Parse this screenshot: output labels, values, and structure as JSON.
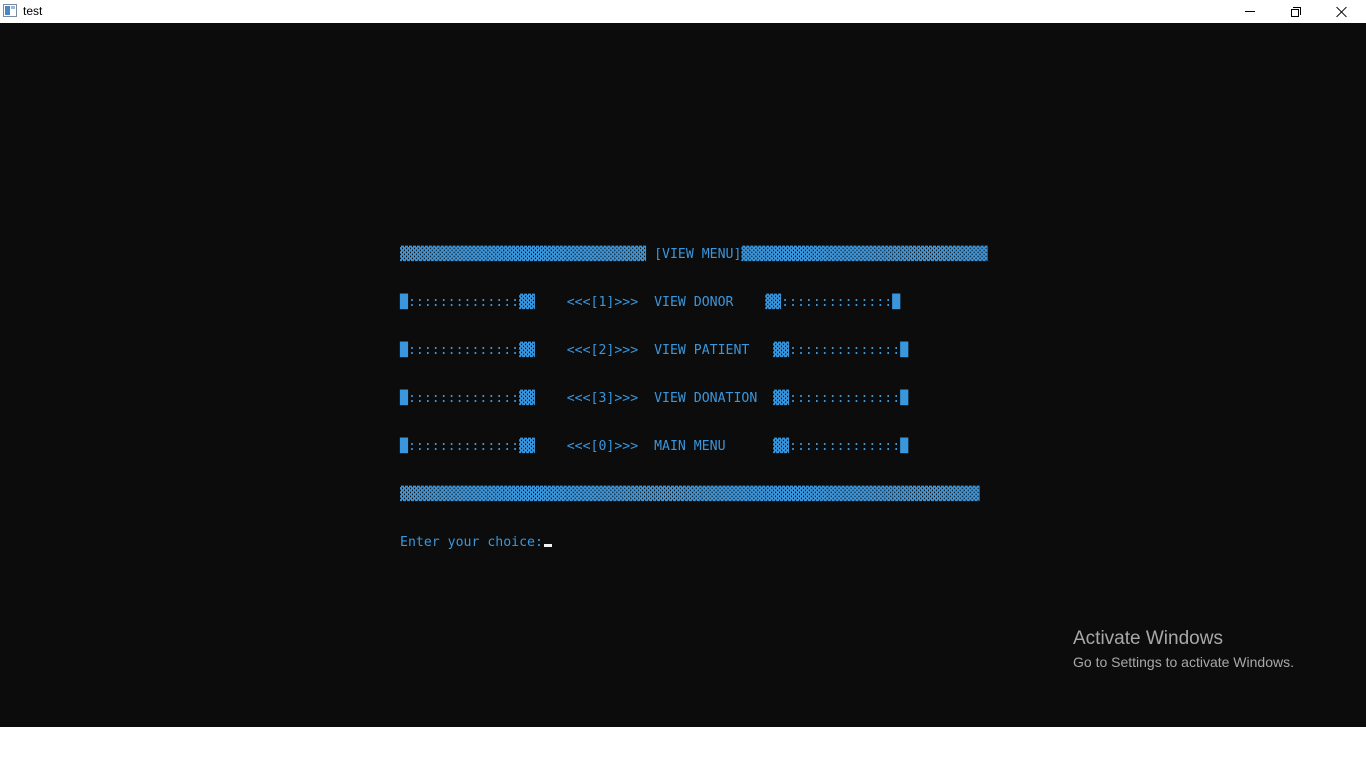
{
  "window": {
    "title": "test",
    "icon": "console-window-icon",
    "controls": [
      "minimize-icon",
      "restore-icon",
      "close-icon"
    ]
  },
  "console": {
    "header": "▓▓▓▓▓▓▓▓▓▓▓▓▓▓▓▓▓▓▓▓▓▓▓▓▓▓▓▓▓▓▓ [VIEW MENU]▓▓▓▓▓▓▓▓▓▓▓▓▓▓▓▓▓▓▓▓▓▓▓▓▓▓▓▓▓▓▓",
    "options": [
      {
        "text": "█::::::::::::::▓▓    <<<[1]>>>  VIEW DONOR    ▓▓::::::::::::::█"
      },
      {
        "text": "█::::::::::::::▓▓    <<<[2]>>>  VIEW PATIENT   ▓▓::::::::::::::█"
      },
      {
        "text": "█::::::::::::::▓▓    <<<[3]>>>  VIEW DONATION  ▓▓::::::::::::::█"
      },
      {
        "text": "█::::::::::::::▓▓    <<<[0]>>>  MAIN MENU      ▓▓::::::::::::::█"
      }
    ],
    "footer": "▓▓▓▓▓▓▓▓▓▓▓▓▓▓▓▓▓▓▓▓▓▓▓▓▓▓▓▓▓▓▓▓▓▓▓▓▓▓▓▓▓▓▓▓▓▓▓▓▓▓▓▓▓▓▓▓▓▓▓▓▓▓▓▓▓▓▓▓▓▓▓▓▓",
    "prompt": "Enter your choice:",
    "text_color": "#3a96dd",
    "background": "#0c0c0c"
  },
  "watermark": {
    "title": "Activate Windows",
    "subtitle": "Go to Settings to activate Windows."
  }
}
